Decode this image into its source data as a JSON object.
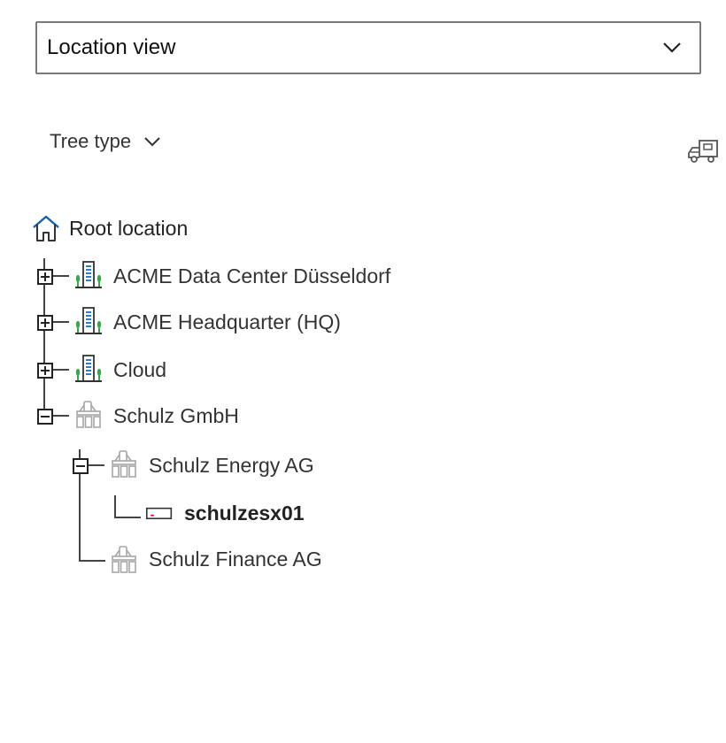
{
  "view_select": {
    "value": "Location view",
    "icon": "chevron-down-icon"
  },
  "tree_type": {
    "label": "Tree type",
    "icon": "chevron-down-icon"
  },
  "toolbar": {
    "truck_icon": "truck-icon"
  },
  "tree": {
    "root": {
      "label": "Root location",
      "icon": "home-icon"
    },
    "nodes": [
      {
        "label": "ACME Data Center Düsseldorf",
        "icon": "building-icon",
        "state": "collapsed"
      },
      {
        "label": "ACME Headquarter (HQ)",
        "icon": "building-icon",
        "state": "collapsed"
      },
      {
        "label": "Cloud",
        "icon": "building-icon",
        "state": "collapsed"
      },
      {
        "label": "Schulz GmbH",
        "icon": "organization-icon",
        "state": "expanded",
        "children": [
          {
            "label": "Schulz Energy AG",
            "icon": "organization-icon",
            "state": "expanded",
            "children": [
              {
                "label": "schulzesx01",
                "icon": "server-icon",
                "selected": true
              }
            ]
          },
          {
            "label": "Schulz Finance AG",
            "icon": "organization-icon",
            "state": "leaf"
          }
        ]
      }
    ]
  },
  "colors": {
    "home_blue": "#1a5fa8",
    "building_blue": "#2a7ec4",
    "tree_green": "#3aa64a",
    "org_gray": "#a6a6a6",
    "server_red": "#d0021b"
  }
}
